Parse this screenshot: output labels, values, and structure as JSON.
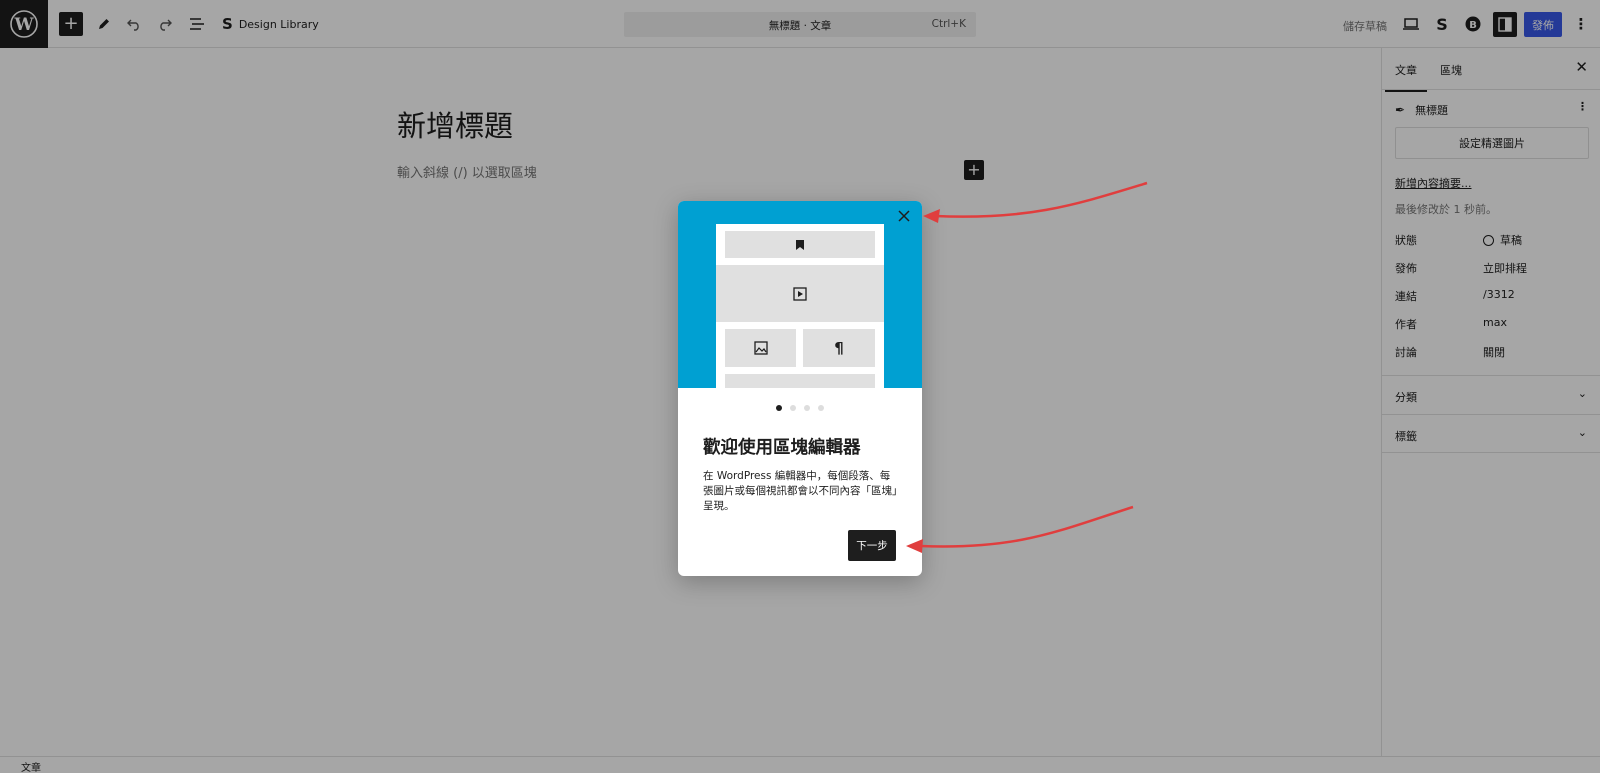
{
  "topbar": {
    "design_library": "Design Library",
    "command_title": "無標題 · 文章",
    "command_shortcut": "Ctrl+K",
    "save_draft": "儲存草稿",
    "publish": "發佈"
  },
  "editor": {
    "title": "新增標題",
    "placeholder": "輸入斜線 (/) 以選取區塊"
  },
  "sidebar": {
    "tabs": [
      "文章",
      "區塊"
    ],
    "post_name": "無標題",
    "featured_image_button": "設定精選圖片",
    "add_excerpt": "新增內容摘要...",
    "last_modified": "最後修改於 1 秒前。",
    "meta": [
      {
        "label": "狀態",
        "value": "草稿"
      },
      {
        "label": "發佈",
        "value": "立即排程"
      },
      {
        "label": "連結",
        "value": "/3312"
      },
      {
        "label": "作者",
        "value": "max"
      },
      {
        "label": "討論",
        "value": "關閉"
      }
    ],
    "panels": [
      "分類",
      "標籤"
    ]
  },
  "statusbar": {
    "breadcrumb": "文章"
  },
  "modal": {
    "heading": "歡迎使用區塊編輯器",
    "body": "在 WordPress 編輯器中，每個段落、每張圖片或每個視訊都會以不同內容「區塊」呈現。",
    "next_button": "下一步",
    "pages_total": 4,
    "current_page": 1
  },
  "colors": {
    "hero": "#00a0d2",
    "annotation_arrow": "#e03e3e",
    "dark": "#1e1e1e",
    "publish": "#3858e9"
  }
}
